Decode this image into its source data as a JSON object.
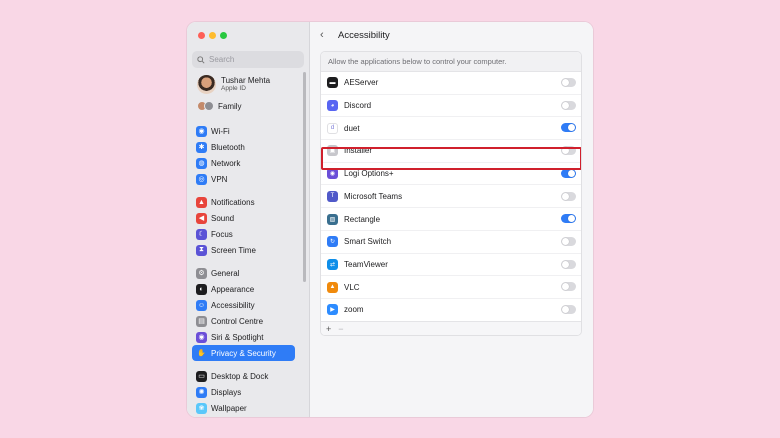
{
  "sidebar": {
    "search_placeholder": "Search",
    "user": {
      "name": "Tushar Mehta",
      "subtitle": "Apple ID"
    },
    "family_label": "Family",
    "items": [
      {
        "label": "Wi-Fi",
        "icon": "wifi-icon",
        "color": "#2f7cf6",
        "glyph": "◉"
      },
      {
        "label": "Bluetooth",
        "icon": "bluetooth-icon",
        "color": "#2f7cf6",
        "glyph": "✱"
      },
      {
        "label": "Network",
        "icon": "globe-icon",
        "color": "#2f7cf6",
        "glyph": "◍"
      },
      {
        "label": "VPN",
        "icon": "vpn-icon",
        "color": "#2f7cf6",
        "glyph": "◎"
      },
      {
        "label": "Notifications",
        "icon": "bell-icon",
        "color": "#e8453c",
        "glyph": "▲"
      },
      {
        "label": "Sound",
        "icon": "speaker-icon",
        "color": "#e8453c",
        "glyph": "◀"
      },
      {
        "label": "Focus",
        "icon": "moon-icon",
        "color": "#5b53d6",
        "glyph": "☾"
      },
      {
        "label": "Screen Time",
        "icon": "hourglass-icon",
        "color": "#5b53d6",
        "glyph": "⧗"
      },
      {
        "label": "General",
        "icon": "gear-icon",
        "color": "#8e8e93",
        "glyph": "⚙"
      },
      {
        "label": "Appearance",
        "icon": "appearance-icon",
        "color": "#1d1d1f",
        "glyph": "◐"
      },
      {
        "label": "Accessibility",
        "icon": "accessibility-icon",
        "color": "#2f7cf6",
        "glyph": "☺"
      },
      {
        "label": "Control Centre",
        "icon": "control-centre-icon",
        "color": "#8e8e93",
        "glyph": "▤"
      },
      {
        "label": "Siri & Spotlight",
        "icon": "siri-icon",
        "color": "#6b4fd8",
        "glyph": "◉"
      },
      {
        "label": "Privacy & Security",
        "icon": "hand-icon",
        "color": "#2f7cf6",
        "glyph": "✋"
      },
      {
        "label": "Desktop & Dock",
        "icon": "desktop-icon",
        "color": "#1d1d1f",
        "glyph": "▭"
      },
      {
        "label": "Displays",
        "icon": "display-icon",
        "color": "#2f7cf6",
        "glyph": "✺"
      },
      {
        "label": "Wallpaper",
        "icon": "wallpaper-icon",
        "color": "#5ac8fa",
        "glyph": "❀"
      }
    ],
    "selected_index": 13
  },
  "main": {
    "title": "Accessibility",
    "description": "Allow the applications below to control your computer.",
    "apps": [
      {
        "name": "AEServer",
        "icon": "terminal-icon",
        "color": "#1d1d1f",
        "glyph": "▬",
        "enabled": false
      },
      {
        "name": "Discord",
        "icon": "discord-icon",
        "color": "#5865f2",
        "glyph": "◕",
        "enabled": false
      },
      {
        "name": "duet",
        "icon": "duet-icon",
        "color": "#ffffff",
        "glyph": "d",
        "enabled": true
      },
      {
        "name": "Installer",
        "icon": "installer-icon",
        "color": "#c7c7cc",
        "glyph": "▣",
        "enabled": false
      },
      {
        "name": "Logi Options+",
        "icon": "logi-icon",
        "color": "#6b4fd8",
        "glyph": "◉",
        "enabled": true
      },
      {
        "name": "Microsoft Teams",
        "icon": "teams-icon",
        "color": "#5059c9",
        "glyph": "T",
        "enabled": false
      },
      {
        "name": "Rectangle",
        "icon": "rectangle-icon",
        "color": "#3a6f8f",
        "glyph": "▧",
        "enabled": true
      },
      {
        "name": "Smart Switch",
        "icon": "smart-switch-icon",
        "color": "#2f7cf6",
        "glyph": "↻",
        "enabled": false
      },
      {
        "name": "TeamViewer",
        "icon": "teamviewer-icon",
        "color": "#0e8ee9",
        "glyph": "⇄",
        "enabled": false
      },
      {
        "name": "VLC",
        "icon": "vlc-icon",
        "color": "#f08a0c",
        "glyph": "▲",
        "enabled": false
      },
      {
        "name": "zoom",
        "icon": "zoom-icon",
        "color": "#2d8cff",
        "glyph": "▶",
        "enabled": false
      }
    ],
    "footer": {
      "add": "+",
      "remove": "−"
    }
  }
}
